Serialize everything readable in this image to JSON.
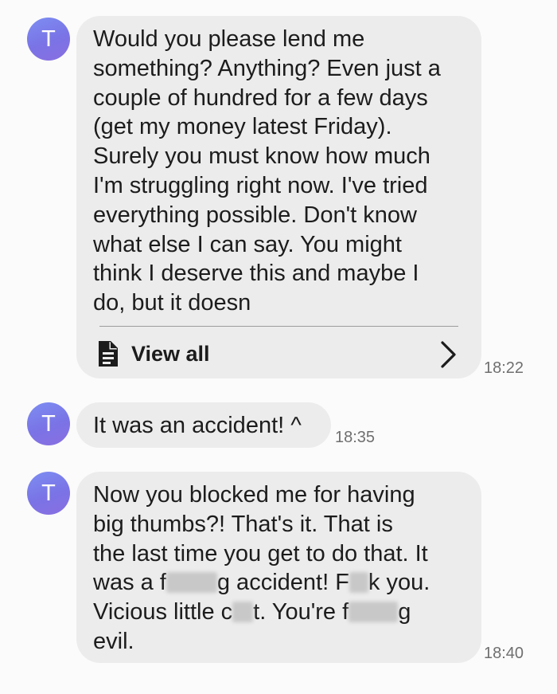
{
  "sender": {
    "initial": "T"
  },
  "messages": [
    {
      "lines": [
        "Would you please lend me",
        "something? Anything? Even just a",
        "couple of hundred for a few days",
        "(get my money latest Friday).",
        "Surely you must know how much",
        "I'm struggling right now. I've tried",
        "everything possible. Don't know",
        "what else I can say. You might",
        "think I deserve this and maybe I",
        "do, but it doesn"
      ],
      "view_all_label": "View all",
      "time": "18:22"
    },
    {
      "lines": [
        "It was an accident! ^"
      ],
      "time": "18:35"
    },
    {
      "segments": {
        "l1": "Now you blocked me for having",
        "l2": "big thumbs?! That's it. That is",
        "l3": "the last time you get to do that. It",
        "l4a": "was a f",
        "l4b": "g accident! F",
        "l4c": "k you.",
        "l5a": "Vicious little c",
        "l5b": "t. You're f",
        "l5c": "g",
        "l6": "evil."
      },
      "time": "18:40"
    }
  ],
  "colors": {
    "bubble": "#ececec",
    "avatar": "#7b80ec",
    "background": "#fbfbfb",
    "timestamp": "#6f6f6f"
  },
  "icons": {
    "document": "document-icon",
    "chevron": "chevron-right-icon"
  }
}
